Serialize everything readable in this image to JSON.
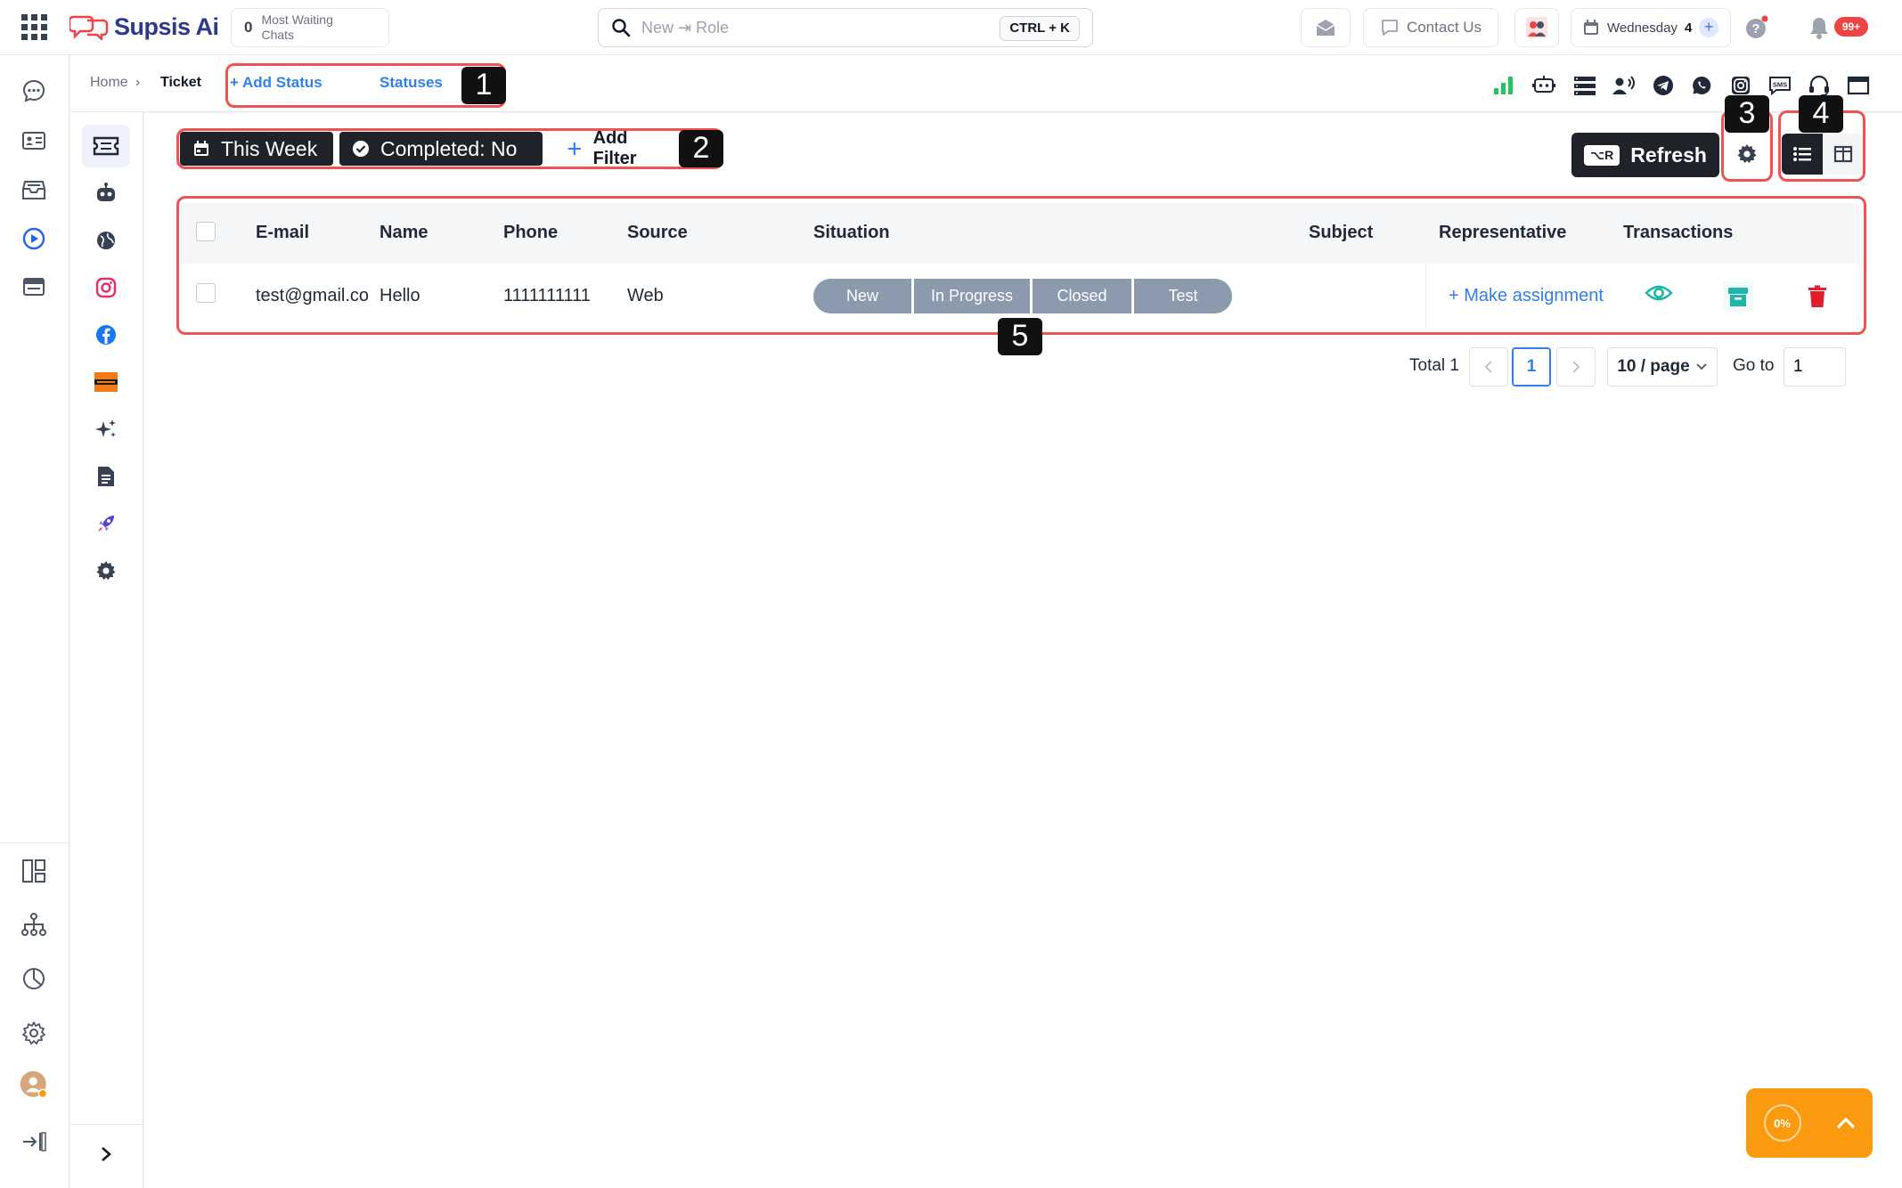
{
  "topbar": {
    "logo_text": "Supsis Ai",
    "waiting_count": "0",
    "waiting_label": "Most Waiting Chats",
    "search_value": "New ⇥ Role",
    "search_shortcut": "CTRL + K",
    "contact_label": "Contact Us",
    "day_label": "Wednesday",
    "day_count": "4",
    "notifications_badge": "99+"
  },
  "breadcrumb": {
    "home": "Home",
    "separator": "›",
    "current": "Ticket",
    "add_status": "+ Add Status",
    "statuses": "Statuses"
  },
  "filters": {
    "this_week": "This Week",
    "completed": "Completed: No",
    "add_filter": "Add Filter"
  },
  "toolbar": {
    "refresh_shortcut": "⌥R",
    "refresh_label": "Refresh"
  },
  "table": {
    "headers": [
      "E-mail",
      "Name",
      "Phone",
      "Source",
      "Situation",
      "Subject",
      "Representative",
      "Transactions"
    ],
    "rows": [
      {
        "email": "test@gmail.com",
        "name": "Hello",
        "phone": "1111111111",
        "source": "Web",
        "statuses": [
          "New",
          "In Progress",
          "Closed",
          "Test"
        ],
        "subject": "",
        "representative_action": "+ Make assignment"
      }
    ]
  },
  "pagination": {
    "total_label": "Total 1",
    "current_page": "1",
    "page_size": "10 / page",
    "goto_label": "Go to",
    "goto_value": "1"
  },
  "annotations": [
    "1",
    "2",
    "3",
    "4",
    "5"
  ],
  "fab": {
    "progress": "0%"
  },
  "colors": {
    "accent_blue": "#2f80ed",
    "annotation_red": "#ef5350",
    "status_gray": "#8c9aad",
    "fab_orange": "#fb9a0e",
    "delete_red": "#e11d2e",
    "view_teal": "#1fb5a8"
  }
}
